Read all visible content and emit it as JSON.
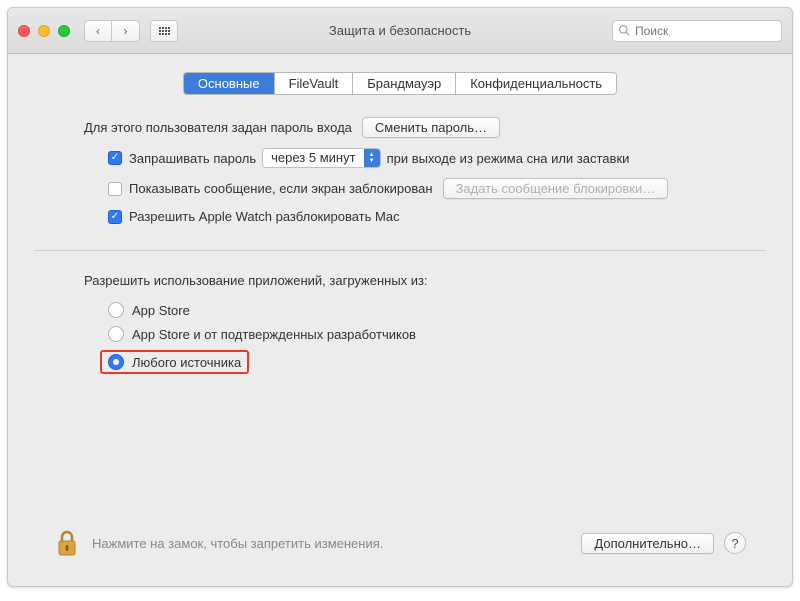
{
  "window": {
    "title": "Защита и безопасность"
  },
  "search": {
    "placeholder": "Поиск"
  },
  "tabs": [
    {
      "label": "Основные",
      "active": true
    },
    {
      "label": "FileVault",
      "active": false
    },
    {
      "label": "Брандмауэр",
      "active": false
    },
    {
      "label": "Конфиденциальность",
      "active": false
    }
  ],
  "general": {
    "password_set_label": "Для этого пользователя задан пароль входа",
    "change_password_btn": "Сменить пароль…",
    "require_password_label": "Запрашивать пароль",
    "require_password_delay": "через 5 минут",
    "require_password_suffix": "при выходе из режима сна или заставки",
    "show_message_label": "Показывать сообщение, если экран заблокирован",
    "set_lock_message_btn": "Задать сообщение блокировки…",
    "allow_apple_watch_label": "Разрешить Apple Watch разблокировать Mac",
    "checkboxes": {
      "require_password": true,
      "show_message": false,
      "allow_apple_watch": true
    }
  },
  "gatekeeper": {
    "section_title": "Разрешить использование приложений, загруженных из:",
    "options": [
      {
        "label": "App Store",
        "selected": false
      },
      {
        "label": "App Store и от подтвержденных разработчиков",
        "selected": false
      },
      {
        "label": "Любого источника",
        "selected": true
      }
    ]
  },
  "footer": {
    "lock_text": "Нажмите на замок, чтобы запретить изменения.",
    "advanced_btn": "Дополнительно…",
    "help": "?"
  }
}
